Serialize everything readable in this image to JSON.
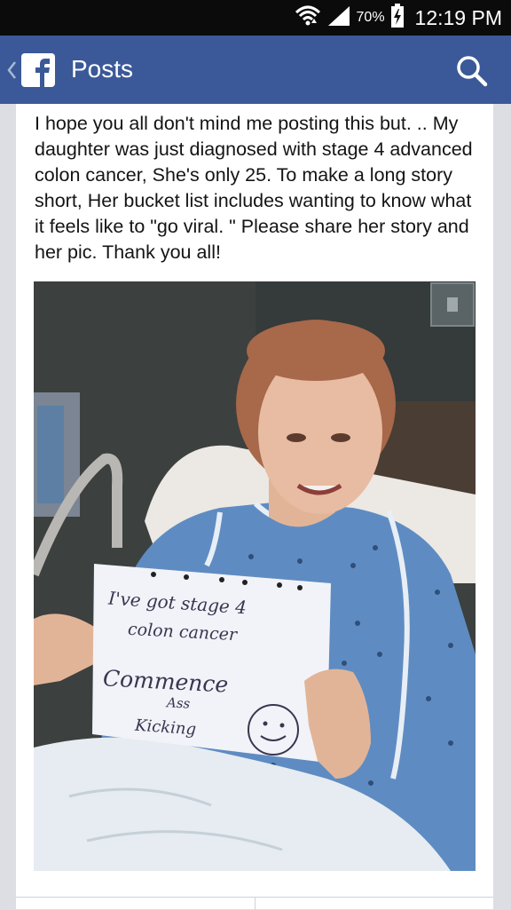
{
  "status_bar": {
    "battery_percent": "70%",
    "time": "12:19 PM",
    "icons": [
      "wifi-icon",
      "cellular-signal-icon",
      "battery-charging-icon"
    ]
  },
  "app_bar": {
    "title": "Posts",
    "back_icon": "chevron-left-icon",
    "logo_icon": "facebook-logo-icon",
    "search_icon": "search-icon",
    "color": "#3b5998"
  },
  "post": {
    "text": "I hope you all don't mind me posting this but. .. My daughter was just diagnosed with stage 4 advanced colon cancer,  She's only 25. To make a long story short,  Her bucket list includes wanting to know what it feels like to \"go viral. \" Please share her story and her pic. Thank you all!",
    "photo": {
      "sign_lines": [
        "I've got stage 4",
        "colon cancer",
        "Commence",
        "Ass",
        "Kicking"
      ]
    }
  }
}
